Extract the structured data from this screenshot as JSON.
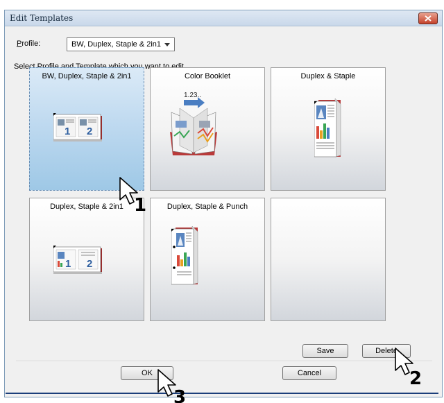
{
  "window": {
    "title": "Edit Templates"
  },
  "profile": {
    "label": "Profile:",
    "value": "BW, Duplex, Staple & 2in1"
  },
  "instruction": "Select Profile and Template which you want to edit",
  "tiles": [
    {
      "name": "BW, Duplex, Staple & 2in1",
      "selected": true
    },
    {
      "name": "Color Booklet",
      "selected": false
    },
    {
      "name": "Duplex & Staple",
      "selected": false
    },
    {
      "name": "Duplex, Staple & 2in1",
      "selected": false
    },
    {
      "name": "Duplex, Staple & Punch",
      "selected": false
    },
    {
      "name": "",
      "selected": false
    }
  ],
  "booklet_label": "1.23..",
  "buttons": {
    "save": "Save",
    "delete": "Delete",
    "ok": "OK",
    "cancel": "Cancel"
  },
  "callouts": [
    "1",
    "2",
    "3"
  ],
  "colors": {
    "title_bg": "#c9d8ea",
    "close_red": "#c5412a",
    "selected_tile": "#bcd8ef",
    "callout_line": "#1b3e7a"
  }
}
